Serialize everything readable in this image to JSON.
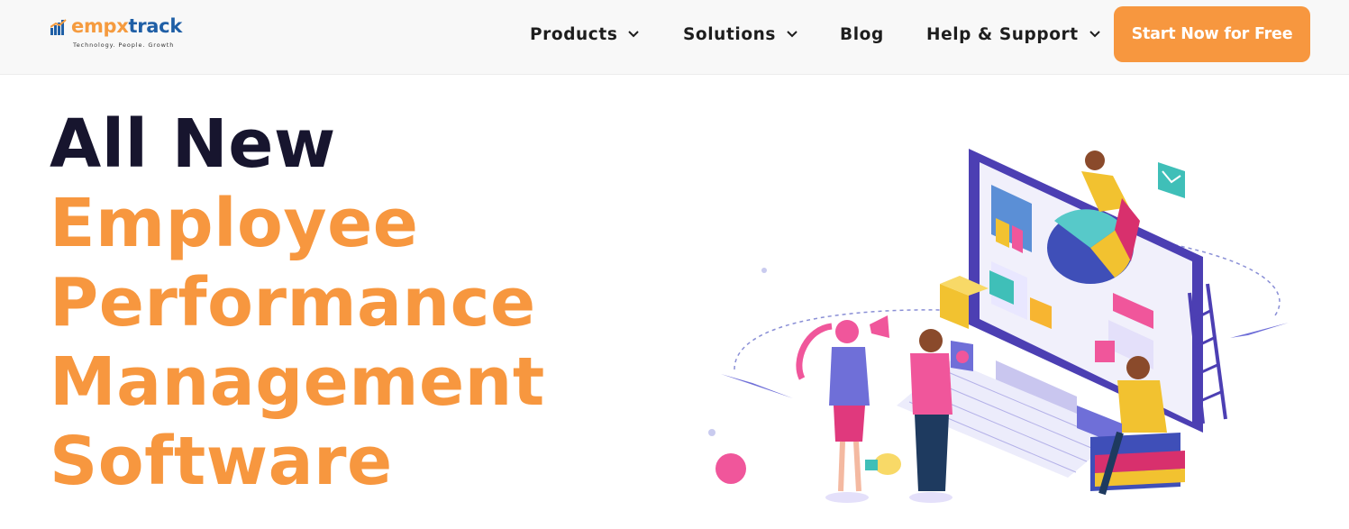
{
  "header": {
    "logo": {
      "name_part1": "empx",
      "name_part2": "track",
      "tagline": "Technology. People. Growth",
      "colors": {
        "empx": "#f59b3f",
        "track": "#1f5fa6"
      }
    },
    "nav": [
      {
        "label": "Products",
        "has_dropdown": true
      },
      {
        "label": "Solutions",
        "has_dropdown": true
      },
      {
        "label": "Blog",
        "has_dropdown": false
      },
      {
        "label": "Help & Support",
        "has_dropdown": true
      }
    ],
    "cta_label": "Start Now for Free",
    "cta_color": "#f7973f"
  },
  "hero": {
    "line1": "All New",
    "line2": "Employee",
    "line3": "Performance",
    "line4": "Management",
    "line5": "Software",
    "colors": {
      "dark": "#17152e",
      "accent": "#f7973f"
    }
  },
  "illustration": {
    "icon": "team-dashboard-illustration"
  }
}
